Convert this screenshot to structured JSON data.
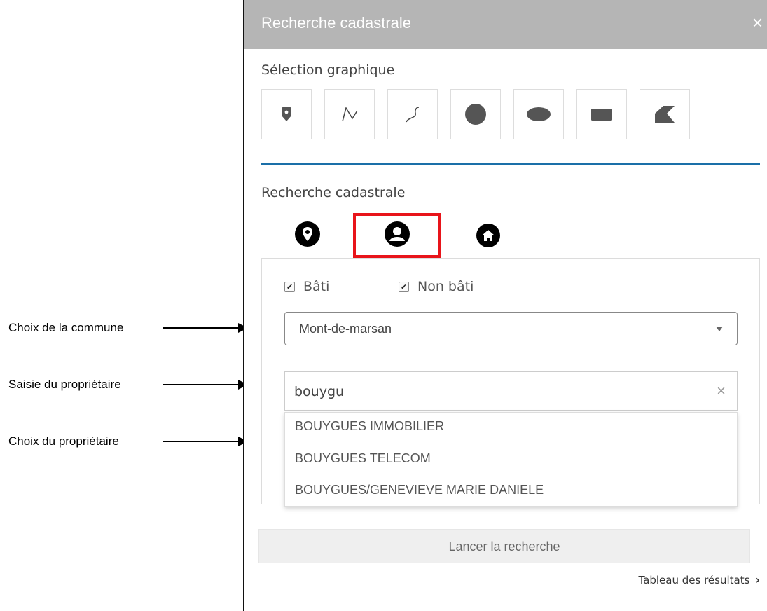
{
  "annotations": [
    {
      "label": "Choix de la commune"
    },
    {
      "label": "Saisie du propriétaire"
    },
    {
      "label": "Choix du propriétaire"
    }
  ],
  "panel": {
    "title": "Recherche cadastrale",
    "close_glyph": "×",
    "graphic_section_label": "Sélection graphique",
    "graphic_tools": [
      "point-tool",
      "polyline-tool",
      "freehand-line-tool",
      "circle-tool",
      "ellipse-tool",
      "rectangle-tool",
      "polygon-tool"
    ],
    "cadastral_section_label": "Recherche cadastrale",
    "tabs": [
      "parcel-location-icon",
      "owner-icon",
      "address-home-icon"
    ],
    "active_tab": "owner-icon",
    "highlight_color": "#e8141a",
    "accent_color": "#1a6fa8",
    "filters": {
      "bati_label": "Bâti",
      "bati_checked": true,
      "non_bati_label": "Non bâti",
      "non_bati_checked": true
    },
    "commune_select": {
      "value": "Mont-de-marsan"
    },
    "owner_search": {
      "value": "bouygu",
      "clear_glyph": "×"
    },
    "owner_suggestions": [
      "BOUYGUES IMMOBILIER",
      "BOUYGUES TELECOM",
      "BOUYGUES/GENEVIEVE MARIE DANIELE"
    ],
    "launch_button": "Lancer la recherche",
    "results_link": "Tableau des résultats",
    "results_chevron": "›"
  }
}
